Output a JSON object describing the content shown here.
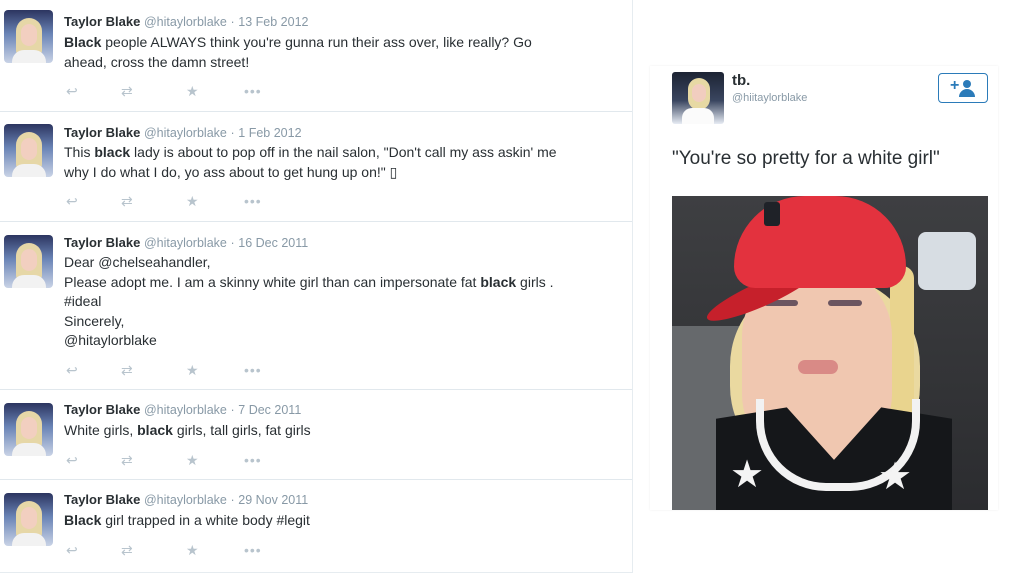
{
  "tweets": [
    {
      "name": "Taylor Blake",
      "handle": "@hitaylorblake",
      "separator": "·",
      "date": "13 Feb 2012",
      "lines": [
        {
          "pre": "",
          "bold": "Black",
          "post": " people ALWAYS think you're gunna run their ass over, like really? Go"
        },
        {
          "pre": "ahead, cross the damn street!",
          "bold": "",
          "post": ""
        }
      ]
    },
    {
      "name": "Taylor Blake",
      "handle": "@hitaylorblake",
      "separator": "·",
      "date": "1 Feb 2012",
      "lines": [
        {
          "pre": "This ",
          "bold": "black",
          "post": " lady is about to pop off in the nail salon, \"Don't call my ass askin' me"
        },
        {
          "pre": "why I do what I do, yo ass about to get hung up on!\" ▯",
          "bold": "",
          "post": ""
        }
      ]
    },
    {
      "name": "Taylor Blake",
      "handle": "@hitaylorblake",
      "separator": "·",
      "date": "16 Dec 2011",
      "lines": [
        {
          "pre": "Dear @chelseahandler,",
          "bold": "",
          "post": ""
        },
        {
          "pre": "Please adopt me. I am a skinny white girl than can impersonate fat ",
          "bold": "black",
          "post": " girls ."
        },
        {
          "pre": "#ideal",
          "bold": "",
          "post": ""
        },
        {
          "pre": "Sincerely,",
          "bold": "",
          "post": ""
        },
        {
          "pre": "@hitaylorblake",
          "bold": "",
          "post": ""
        }
      ]
    },
    {
      "name": "Taylor Blake",
      "handle": "@hitaylorblake",
      "separator": "·",
      "date": "7 Dec 2011",
      "lines": [
        {
          "pre": "White girls, ",
          "bold": "black",
          "post": " girls, tall girls, fat girls"
        }
      ]
    },
    {
      "name": "Taylor Blake",
      "handle": "@hitaylorblake",
      "separator": "·",
      "date": "29 Nov 2011",
      "lines": [
        {
          "pre": "",
          "bold": "Black",
          "post": " girl trapped in a white body #legit"
        }
      ]
    }
  ],
  "actions": {
    "reply_icon": "↩",
    "retweet_icon": "⇄",
    "favorite_icon": "★",
    "more_icon": "•••"
  },
  "card": {
    "name": "tb.",
    "handle": "@hiitaylorblake",
    "follow_plus": "+",
    "quote": "\"You're so pretty for a white girl\""
  }
}
